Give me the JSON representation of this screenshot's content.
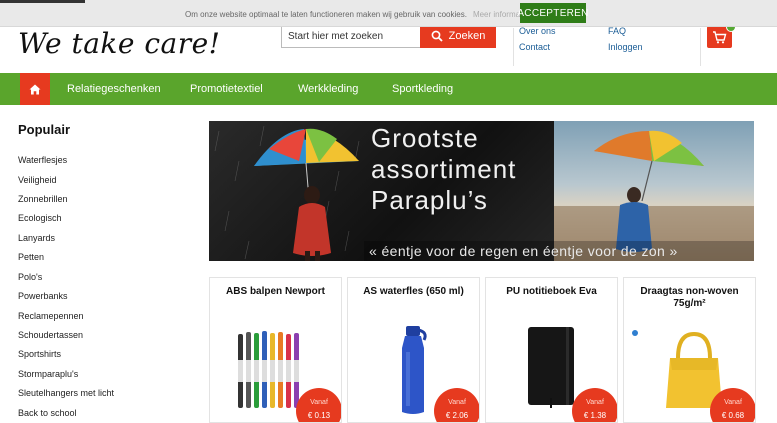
{
  "cookie": {
    "message": "Om onze website optimaal te laten functioneren maken wij gebruik van cookies.",
    "more_info": "Meer informatie",
    "accept_label": "ACCEPTEREN"
  },
  "header": {
    "logo_text": "We take care!",
    "search_placeholder": "Start hier met zoeken",
    "search_button": "Zoeken",
    "links": [
      {
        "label": "Over ons"
      },
      {
        "label": "Contact"
      },
      {
        "label": "FAQ"
      },
      {
        "label": "Inloggen"
      }
    ],
    "cart_icon": "cart-icon"
  },
  "nav": {
    "home_icon": "home-icon",
    "items": [
      {
        "label": "Relatiegeschenken"
      },
      {
        "label": "Promotietextiel"
      },
      {
        "label": "Werkkleding"
      },
      {
        "label": "Sportkleding"
      }
    ]
  },
  "sidebar": {
    "title": "Populair",
    "items": [
      {
        "label": "Waterflesjes"
      },
      {
        "label": "Veiligheid"
      },
      {
        "label": "Zonnebrillen"
      },
      {
        "label": "Ecologisch"
      },
      {
        "label": "Lanyards"
      },
      {
        "label": "Petten"
      },
      {
        "label": "Polo's"
      },
      {
        "label": "Powerbanks"
      },
      {
        "label": "Reclamepennen"
      },
      {
        "label": "Schoudertassen"
      },
      {
        "label": "Sportshirts"
      },
      {
        "label": "Stormparaplu's"
      },
      {
        "label": "Sleutelhangers met licht"
      },
      {
        "label": "Back to school"
      }
    ]
  },
  "banner": {
    "headline_1": "Grootste",
    "headline_2": "assortiment",
    "headline_3": "Paraplu’s",
    "tagline": "« éentje voor de regen en éentje voor de zon »"
  },
  "products": [
    {
      "title": "ABS balpen Newport",
      "from_label": "Vanaf",
      "price": "€ 0.13"
    },
    {
      "title": "AS waterfles (650 ml)",
      "from_label": "Vanaf",
      "price": "€ 2.06"
    },
    {
      "title": "PU notitieboek Eva",
      "from_label": "Vanaf",
      "price": "€ 1.38"
    },
    {
      "title": "Draagtas non-woven 75g/m²",
      "from_label": "Vanaf",
      "price": "€ 0.68"
    }
  ],
  "colors": {
    "brand_green": "#5aa52c",
    "accent_red": "#e63a1f",
    "accept_green": "#2f7d18",
    "link_blue": "#1b5d96"
  }
}
